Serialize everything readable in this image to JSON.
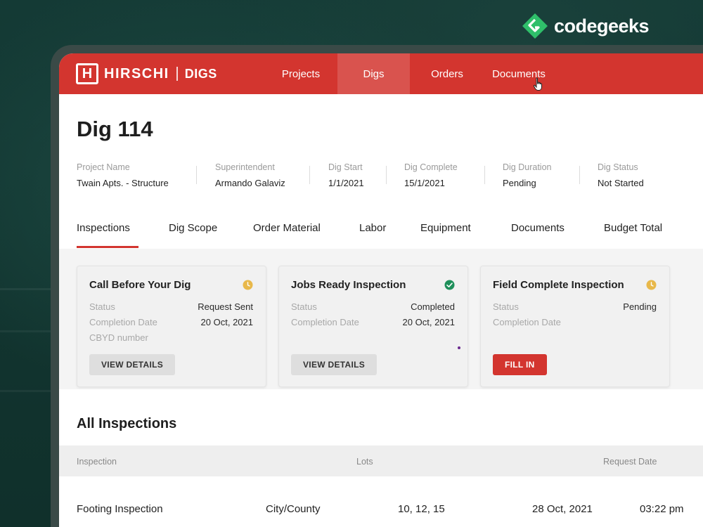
{
  "brand": {
    "name": "codegeeks",
    "logo_icon": "codegeeks-diamond-logo",
    "color": "#2fbf6a"
  },
  "app": {
    "logo_text": "HIRSCHI",
    "logo_sub": "DIGS",
    "accent": "#d3352f"
  },
  "nav": {
    "tabs": [
      {
        "label": "Projects",
        "active": false
      },
      {
        "label": "Digs",
        "active": true
      },
      {
        "label": "Orders",
        "active": false
      },
      {
        "label": "Documents",
        "active": false
      }
    ]
  },
  "page": {
    "title": "Dig 114"
  },
  "meta": [
    {
      "label": "Project Name",
      "value": "Twain Apts. - Structure"
    },
    {
      "label": "Superintendent",
      "value": "Armando Galaviz"
    },
    {
      "label": "Dig Start",
      "value": "1/1/2021"
    },
    {
      "label": "Dig Complete",
      "value": "15/1/2021"
    },
    {
      "label": "Dig Duration",
      "value": "Pending"
    },
    {
      "label": "Dig Status",
      "value": "Not Started"
    }
  ],
  "section_tabs": [
    {
      "label": "Inspections",
      "active": true
    },
    {
      "label": "Dig Scope",
      "active": false
    },
    {
      "label": "Order Material",
      "active": false
    },
    {
      "label": "Labor",
      "active": false
    },
    {
      "label": "Equipment",
      "active": false
    },
    {
      "label": "Documents",
      "active": false
    },
    {
      "label": "Budget Total",
      "active": false
    }
  ],
  "cards": [
    {
      "title": "Call Before Your Dig",
      "status_icon": "clock-icon",
      "status_color": "#e8b84a",
      "rows": [
        {
          "label": "Status",
          "value": "Request Sent"
        },
        {
          "label": "Completion Date",
          "value": "20 Oct, 2021"
        },
        {
          "label": "CBYD number",
          "value": ""
        }
      ],
      "button": "VIEW DETAILS"
    },
    {
      "title": "Jobs Ready Inspection",
      "status_icon": "check-circle-icon",
      "status_color": "#1e8f5a",
      "rows": [
        {
          "label": "Status",
          "value": "Completed"
        },
        {
          "label": "Completion Date",
          "value": "20 Oct, 2021"
        }
      ],
      "button": "VIEW DETAILS"
    },
    {
      "title": "Field Complete Inspection",
      "status_icon": "clock-icon",
      "status_color": "#e8b84a",
      "rows": [
        {
          "label": "Status",
          "value": "Pending"
        },
        {
          "label": "Completion Date",
          "value": ""
        }
      ],
      "button": "FILL IN"
    }
  ],
  "all_inspections": {
    "title": "All Inspections",
    "columns": [
      "Inspection",
      "Lots",
      "Request Date"
    ],
    "rows": [
      {
        "inspection": "Footing Inspection",
        "authority": "City/County",
        "lots": "10, 12, 15",
        "request_date": "28 Oct, 2021",
        "time": "03:22 pm"
      }
    ]
  }
}
